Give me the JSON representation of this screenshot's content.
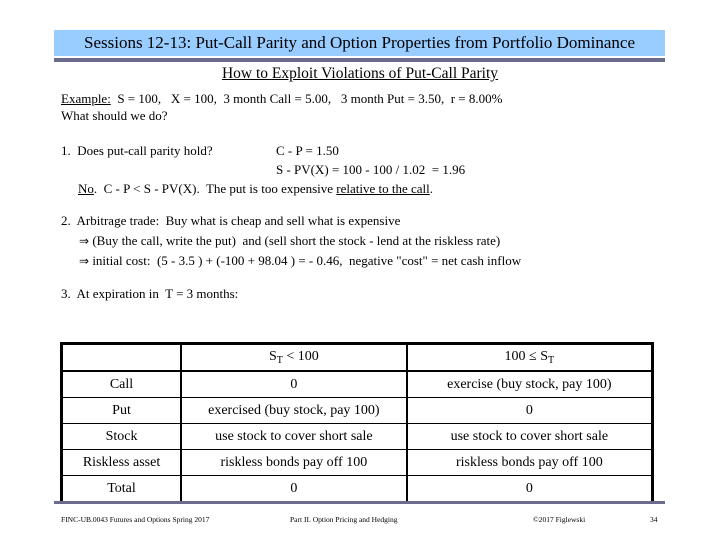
{
  "header": {
    "title": "Sessions 12-13:  Put-Call Parity and Option Properties from Portfolio Dominance",
    "subtitle": "How to Exploit Violations of Put-Call Parity",
    "band_color": "#99ccff",
    "rule_color": "#6b6b8e"
  },
  "example": {
    "label": "Example:",
    "text": "  S = 100,   X = 100,  3 month Call = 5.00,   3 month Put = 3.50,  r = 8.00%",
    "question": "What should we do?"
  },
  "step1": {
    "label": "1.  Does put-call parity hold?",
    "eq1": "C - P = 1.50",
    "eq2": "S - PV(X) = 100 - 100 / 1.02  = 1.96",
    "no": "No",
    "conclusion": ".  C - P < S - PV(X).  The put is too expensive ",
    "conclusion_underlined": "relative to the call",
    "period": "."
  },
  "step2": {
    "label": "2.  Arbitrage trade:  Buy what is cheap and sell what is expensive",
    "arrow": "⇒",
    "line1": " (Buy the call, write the put)  and (sell short the stock - lend at the riskless rate)",
    "line2": " initial cost:  (5 - 3.5 ) + (-100 + 98.04 ) = - 0.46,  negative \"cost\" = net cash inflow"
  },
  "step3": {
    "label": "3.  At expiration in  T = 3 months:"
  },
  "table": {
    "header": {
      "col1_main": "S",
      "col1_sub": "T",
      "col1_rest": " < 100",
      "col2_pre": "100 ≤ S",
      "col2_sub": "T"
    },
    "rows": [
      {
        "label": "Call",
        "below": "0",
        "above": "exercise (buy stock, pay 100)"
      },
      {
        "label": "Put",
        "below": "exercised (buy stock, pay 100)",
        "above": "0"
      },
      {
        "label": "Stock",
        "below": "use stock to cover short sale",
        "above": "use stock to cover short sale"
      },
      {
        "label": "Riskless asset",
        "below": "riskless bonds pay off 100",
        "above": "riskless bonds pay off 100"
      },
      {
        "label": "Total",
        "below": "0",
        "above": "0"
      }
    ]
  },
  "footer": {
    "course": "FINC-UB.0043  Futures and Options  Spring 2017",
    "part": "Part II. Option Pricing and Hedging",
    "copyright": "©2017 Figlewski",
    "page": "34"
  }
}
